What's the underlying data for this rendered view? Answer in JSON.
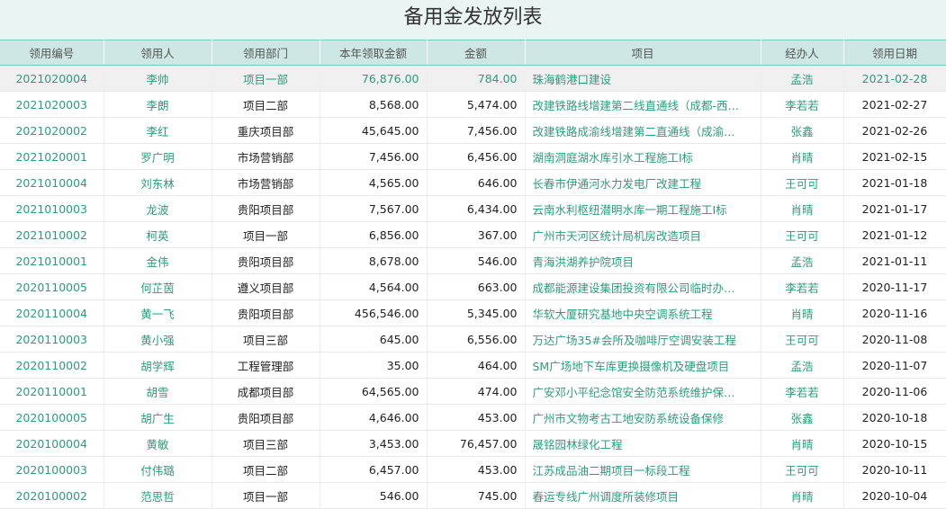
{
  "title": "备用金发放列表",
  "columns": [
    "领用编号",
    "领用人",
    "领用部门",
    "本年领取金额",
    "金额",
    "项目",
    "经办人",
    "领用日期"
  ],
  "rows": [
    {
      "id": "2021020004",
      "person": "李帅",
      "dept": "项目一部",
      "year_total": "76,876.00",
      "amount": "784.00",
      "project": "珠海鹤港口建设",
      "handler": "孟浩",
      "date": "2021-02-28"
    },
    {
      "id": "2021020003",
      "person": "李朗",
      "dept": "项目二部",
      "year_total": "8,568.00",
      "amount": "5,474.00",
      "project": "改建铁路线增建第二线直通线（成都-西…",
      "handler": "李若若",
      "date": "2021-02-27"
    },
    {
      "id": "2021020002",
      "person": "李红",
      "dept": "重庆项目部",
      "year_total": "45,645.00",
      "amount": "7,456.00",
      "project": "改建铁路成渝线增建第二直通线（成渝…",
      "handler": "张鑫",
      "date": "2021-02-26"
    },
    {
      "id": "2021020001",
      "person": "罗广明",
      "dept": "市场营销部",
      "year_total": "7,456.00",
      "amount": "6,456.00",
      "project": "湖南洞庭湖水库引水工程施工I标",
      "handler": "肖晴",
      "date": "2021-02-15"
    },
    {
      "id": "2021010004",
      "person": "刘东林",
      "dept": "市场营销部",
      "year_total": "4,565.00",
      "amount": "646.00",
      "project": "长春市伊通河水力发电厂改建工程",
      "handler": "王可可",
      "date": "2021-01-18"
    },
    {
      "id": "2021010003",
      "person": "龙波",
      "dept": "贵阳项目部",
      "year_total": "7,567.00",
      "amount": "6,434.00",
      "project": "云南水利枢纽潜明水库一期工程施工I标",
      "handler": "肖晴",
      "date": "2021-01-17"
    },
    {
      "id": "2021010002",
      "person": "柯英",
      "dept": "项目一部",
      "year_total": "6,856.00",
      "amount": "367.00",
      "project": "广州市天河区统计局机房改造项目",
      "handler": "王可可",
      "date": "2021-01-12"
    },
    {
      "id": "2021010001",
      "person": "金伟",
      "dept": "贵阳项目部",
      "year_total": "8,678.00",
      "amount": "546.00",
      "project": "青海洪湖养护院项目",
      "handler": "孟浩",
      "date": "2021-01-11"
    },
    {
      "id": "2020110005",
      "person": "何芷茵",
      "dept": "遵义项目部",
      "year_total": "4,564.00",
      "amount": "663.00",
      "project": "成都能源建设集团投资有限公司临时办…",
      "handler": "李若若",
      "date": "2020-11-17"
    },
    {
      "id": "2020110004",
      "person": "黄一飞",
      "dept": "贵阳项目部",
      "year_total": "456,546.00",
      "amount": "5,345.00",
      "project": "华软大厦研究基地中央空调系统工程",
      "handler": "肖晴",
      "date": "2020-11-16"
    },
    {
      "id": "2020110003",
      "person": "黄小强",
      "dept": "项目三部",
      "year_total": "645.00",
      "amount": "6,556.00",
      "project": "万达广场35#会所及咖啡厅空调安装工程",
      "handler": "王可可",
      "date": "2020-11-08"
    },
    {
      "id": "2020110002",
      "person": "胡学辉",
      "dept": "工程管理部",
      "year_total": "35.00",
      "amount": "464.00",
      "project": "SM广场地下车库更换摄像机及硬盘项目",
      "handler": "孟浩",
      "date": "2020-11-07"
    },
    {
      "id": "2020110001",
      "person": "胡雪",
      "dept": "成都项目部",
      "year_total": "64,565.00",
      "amount": "474.00",
      "project": "广安邓小平纪念馆安全防范系统维护保…",
      "handler": "李若若",
      "date": "2020-11-06"
    },
    {
      "id": "2020100005",
      "person": "胡广生",
      "dept": "贵阳项目部",
      "year_total": "4,646.00",
      "amount": "453.00",
      "project": "广州市文物考古工地安防系统设备保修",
      "handler": "张鑫",
      "date": "2020-10-18"
    },
    {
      "id": "2020100004",
      "person": "黄敏",
      "dept": "项目三部",
      "year_total": "3,453.00",
      "amount": "76,457.00",
      "project": "晟铭园林绿化工程",
      "handler": "肖晴",
      "date": "2020-10-15"
    },
    {
      "id": "2020100003",
      "person": "付伟璐",
      "dept": "项目二部",
      "year_total": "6,457.00",
      "amount": "453.00",
      "project": "江苏成品油二期项目一标段工程",
      "handler": "王可可",
      "date": "2020-10-11"
    },
    {
      "id": "2020100002",
      "person": "范思哲",
      "dept": "项目一部",
      "year_total": "546.00",
      "amount": "745.00",
      "project": "春运专线广州调度所装修项目",
      "handler": "肖晴",
      "date": "2020-10-04"
    }
  ],
  "colors": {
    "teal": "#2e9b7c",
    "header_bg": "#cde8e2",
    "title_bg": "#eaf5f3",
    "selected_row": "#f0f0f0"
  }
}
